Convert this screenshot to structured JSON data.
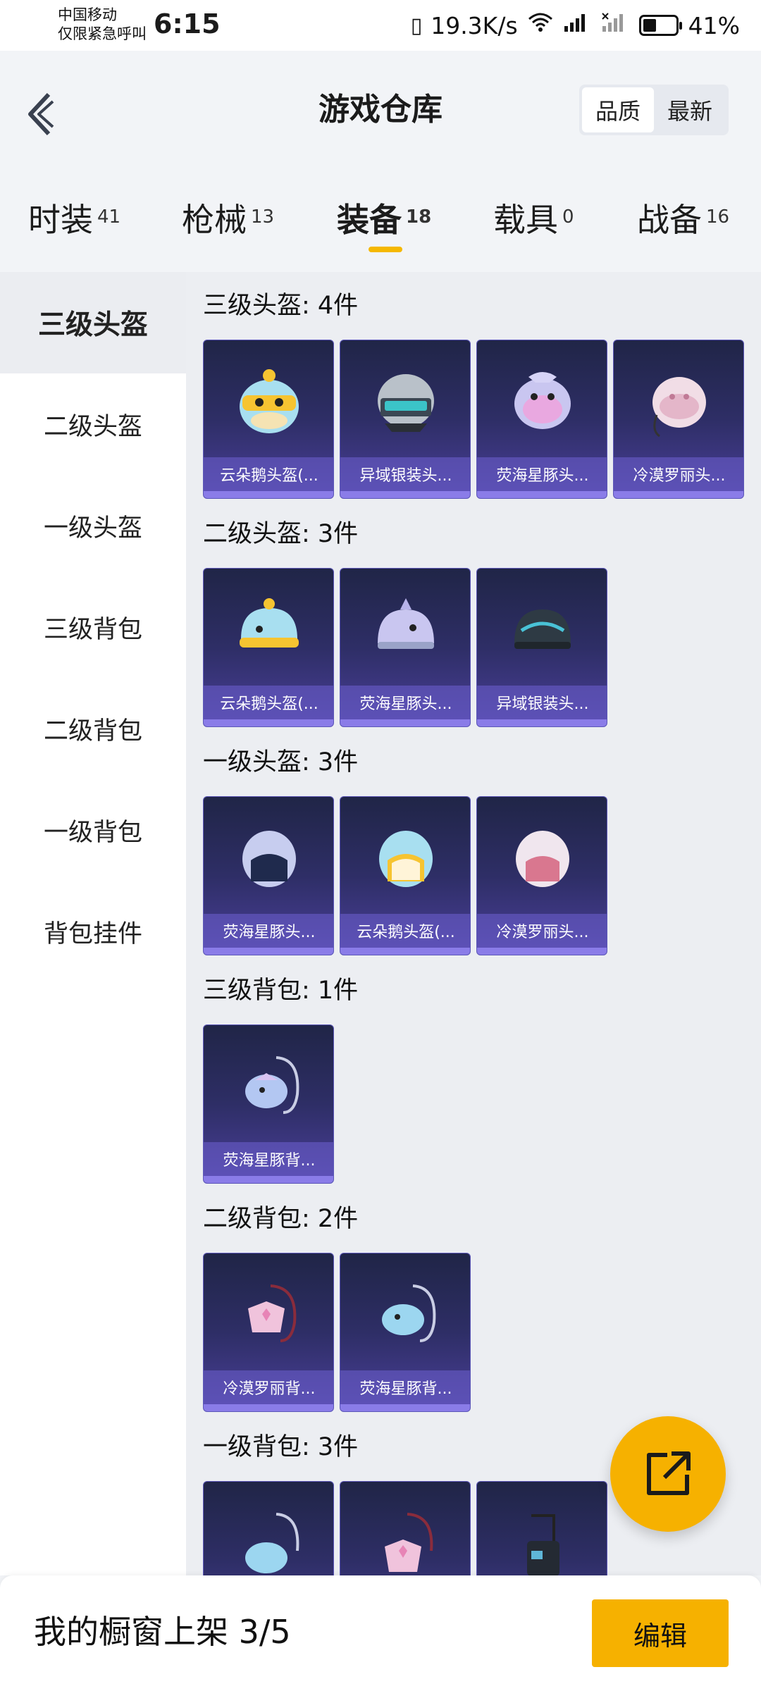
{
  "status_bar": {
    "carrier_line1": "中国移动",
    "carrier_line2": "仅限紧急呼叫",
    "time": "6:15",
    "speed": "19.3K/s",
    "battery": "41%",
    "battery_level": 0.41
  },
  "header": {
    "title": "游戏仓库",
    "sort_options": [
      "品质",
      "最新"
    ],
    "sort_selected": "品质"
  },
  "tabs": [
    {
      "label": "时装",
      "count": "41"
    },
    {
      "label": "枪械",
      "count": "13"
    },
    {
      "label": "装备",
      "count": "18"
    },
    {
      "label": "载具",
      "count": "0"
    },
    {
      "label": "战备",
      "count": "16"
    }
  ],
  "active_tab": "装备",
  "sidebar": {
    "items": [
      "三级头盔",
      "二级头盔",
      "一级头盔",
      "三级背包",
      "二级背包",
      "一级背包",
      "背包挂件"
    ],
    "active": "三级头盔"
  },
  "sections": [
    {
      "title": "三级头盔: 4件",
      "items": [
        "云朵鹅头盔(...",
        "异域银装头...",
        "荧海星豚头...",
        "冷漠罗丽头..."
      ]
    },
    {
      "title": "二级头盔: 3件",
      "items": [
        "云朵鹅头盔(...",
        "荧海星豚头...",
        "异域银装头..."
      ]
    },
    {
      "title": "一级头盔: 3件",
      "items": [
        "荧海星豚头...",
        "云朵鹅头盔(...",
        "冷漠罗丽头..."
      ]
    },
    {
      "title": "三级背包: 1件",
      "items": [
        "荧海星豚背..."
      ]
    },
    {
      "title": "二级背包: 2件",
      "items": [
        "冷漠罗丽背...",
        "荧海星豚背..."
      ]
    },
    {
      "title": "一级背包: 3件",
      "items": [
        "",
        "",
        ""
      ]
    }
  ],
  "bottom_bar": {
    "showcase_text": "我的橱窗上架 3/5",
    "edit_label": "编辑"
  },
  "icons": {
    "back": "chevron-left-icon",
    "share": "share-external-icon"
  },
  "colors": {
    "accent": "#f6b100",
    "card_bg": "#2e2e66",
    "card_label_bg": "#6e60d2"
  }
}
